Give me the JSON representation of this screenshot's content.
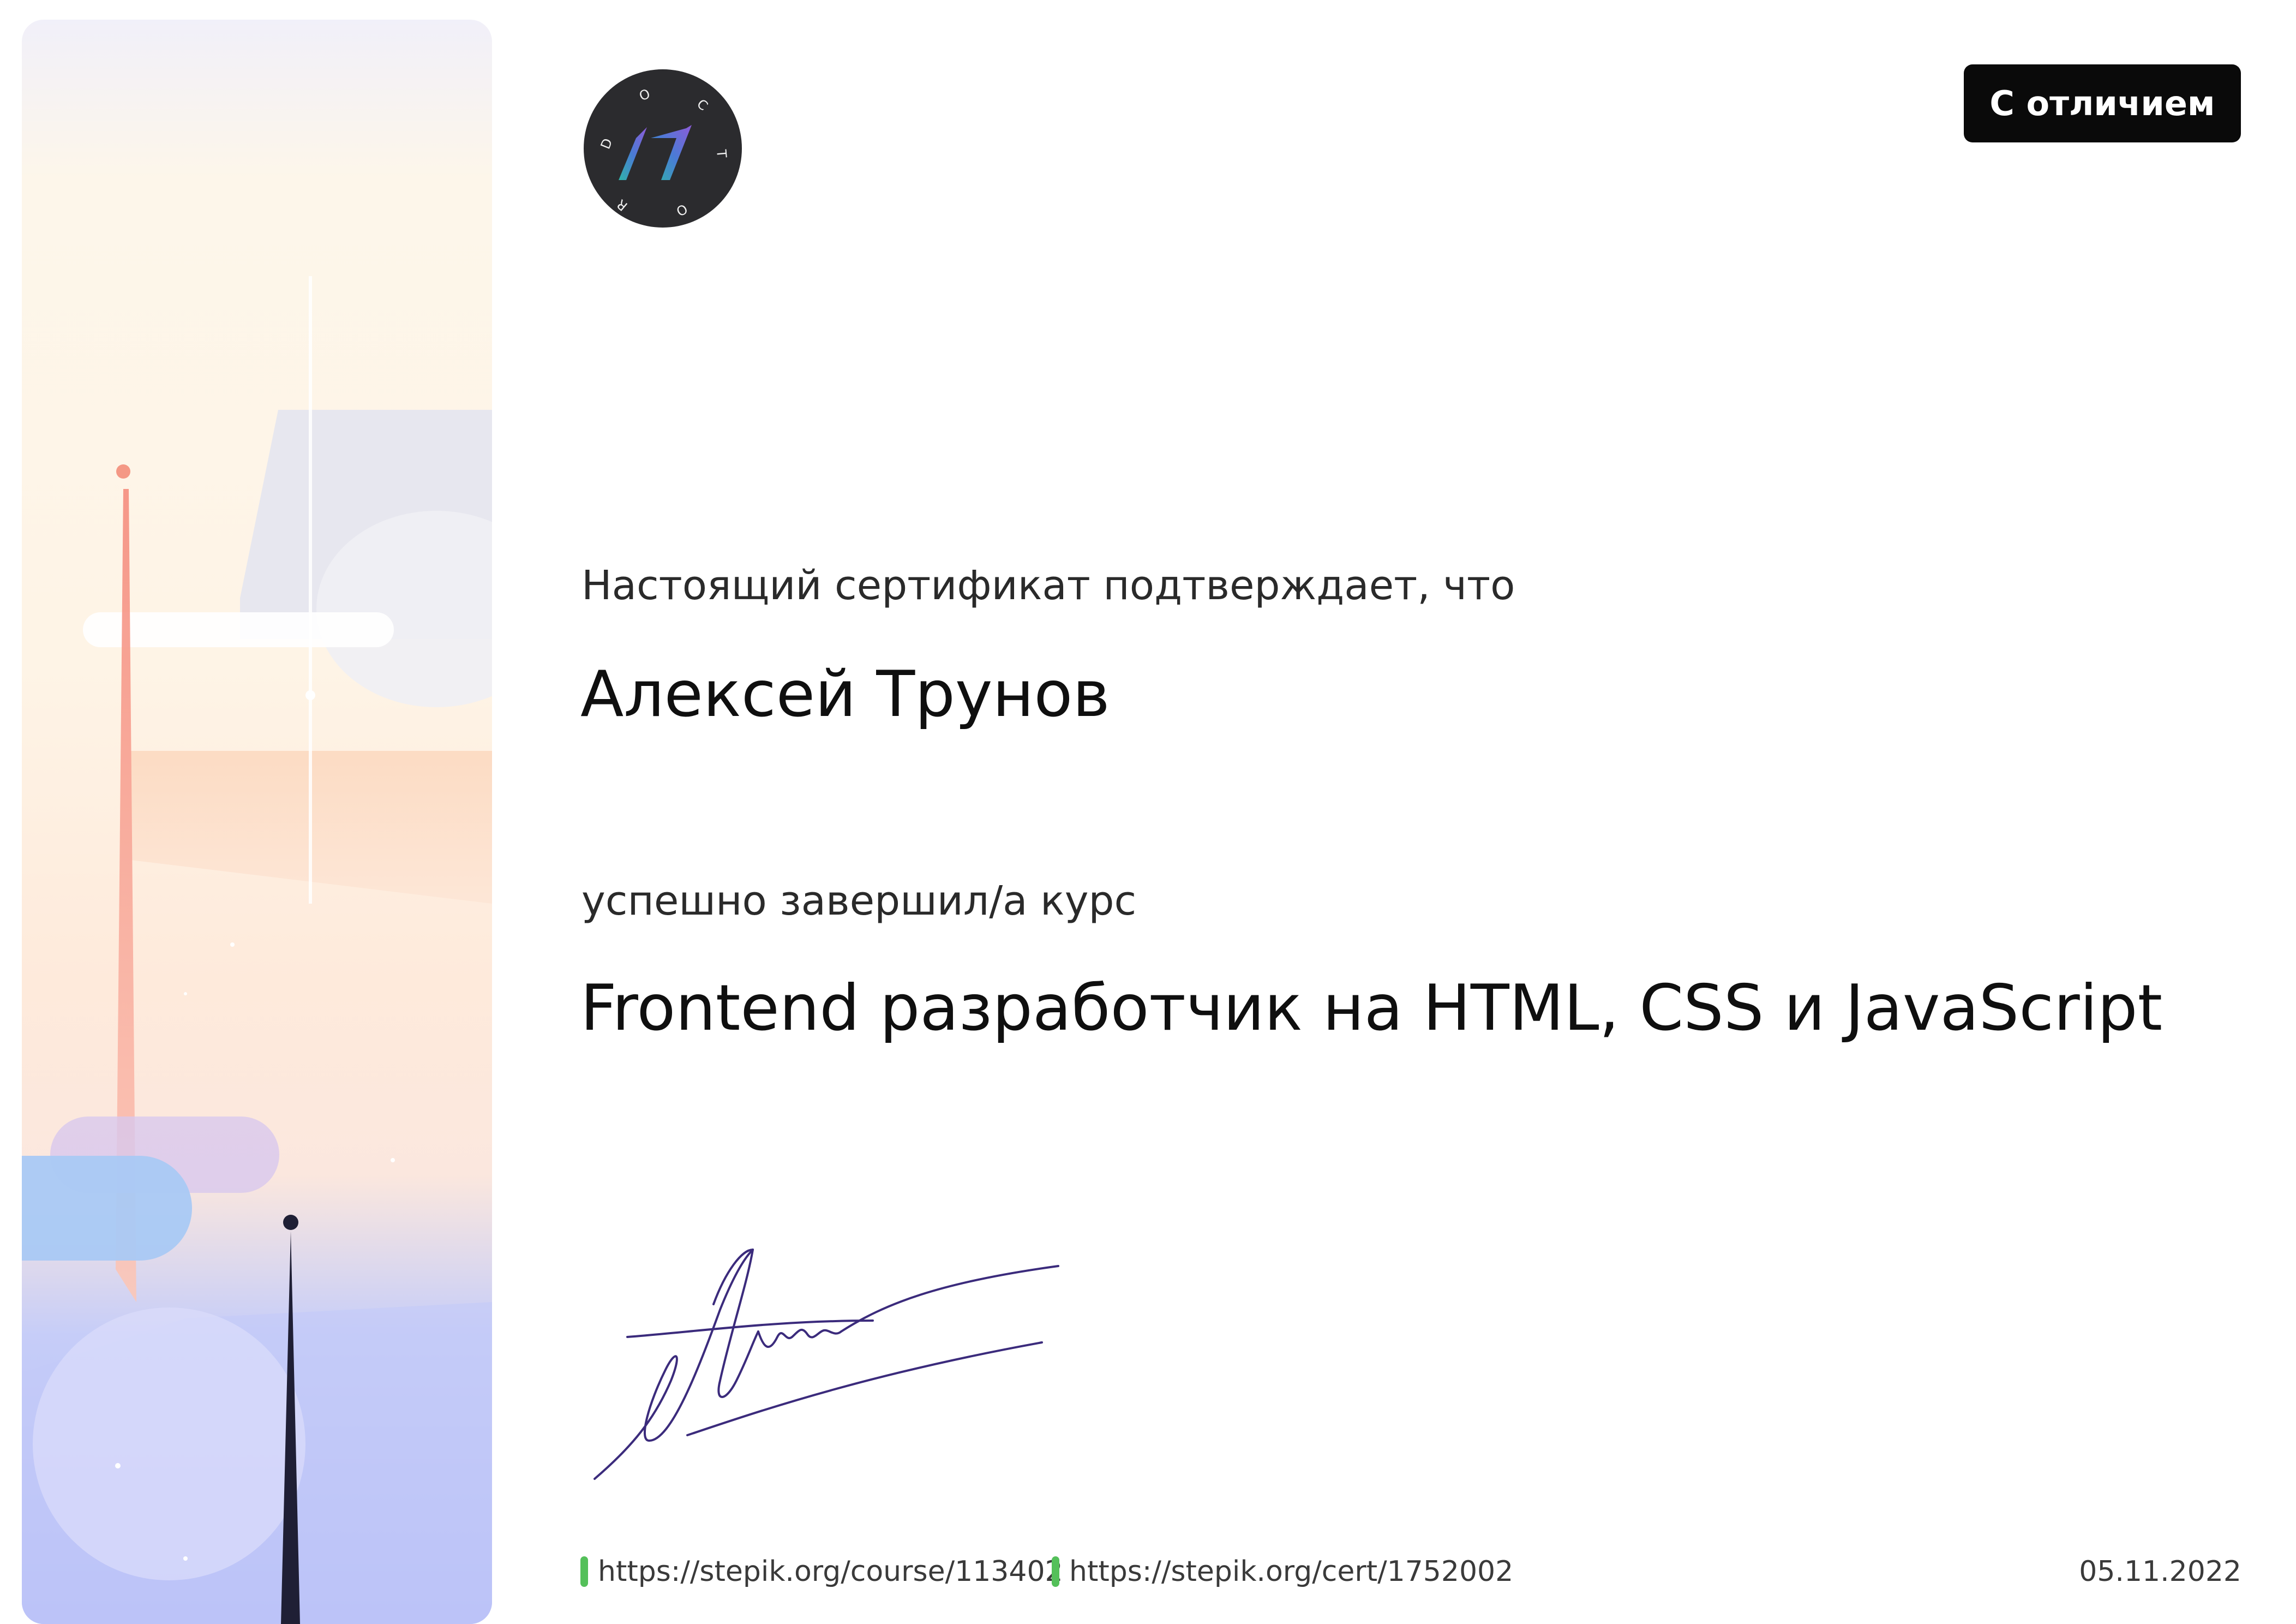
{
  "badge": {
    "label": "С отличием"
  },
  "logo": {
    "letters": [
      "D",
      "O",
      "C",
      "T",
      "O",
      "R"
    ]
  },
  "certificate": {
    "lead": "Настоящий сертификат подтверждает, что",
    "recipient": "Алексей Трунов",
    "completed_text": "успешно завершил/а  курс",
    "course_title": "Frontend разработчик на HTML, CSS и JavaScript"
  },
  "footer": {
    "course_link": "https://stepik.org/course/113402",
    "cert_link": "https://stepik.org/cert/1752002",
    "date": "05.11.2022"
  },
  "colors": {
    "link_marker": "#54c05a",
    "badge_bg": "#0a0a0a"
  }
}
